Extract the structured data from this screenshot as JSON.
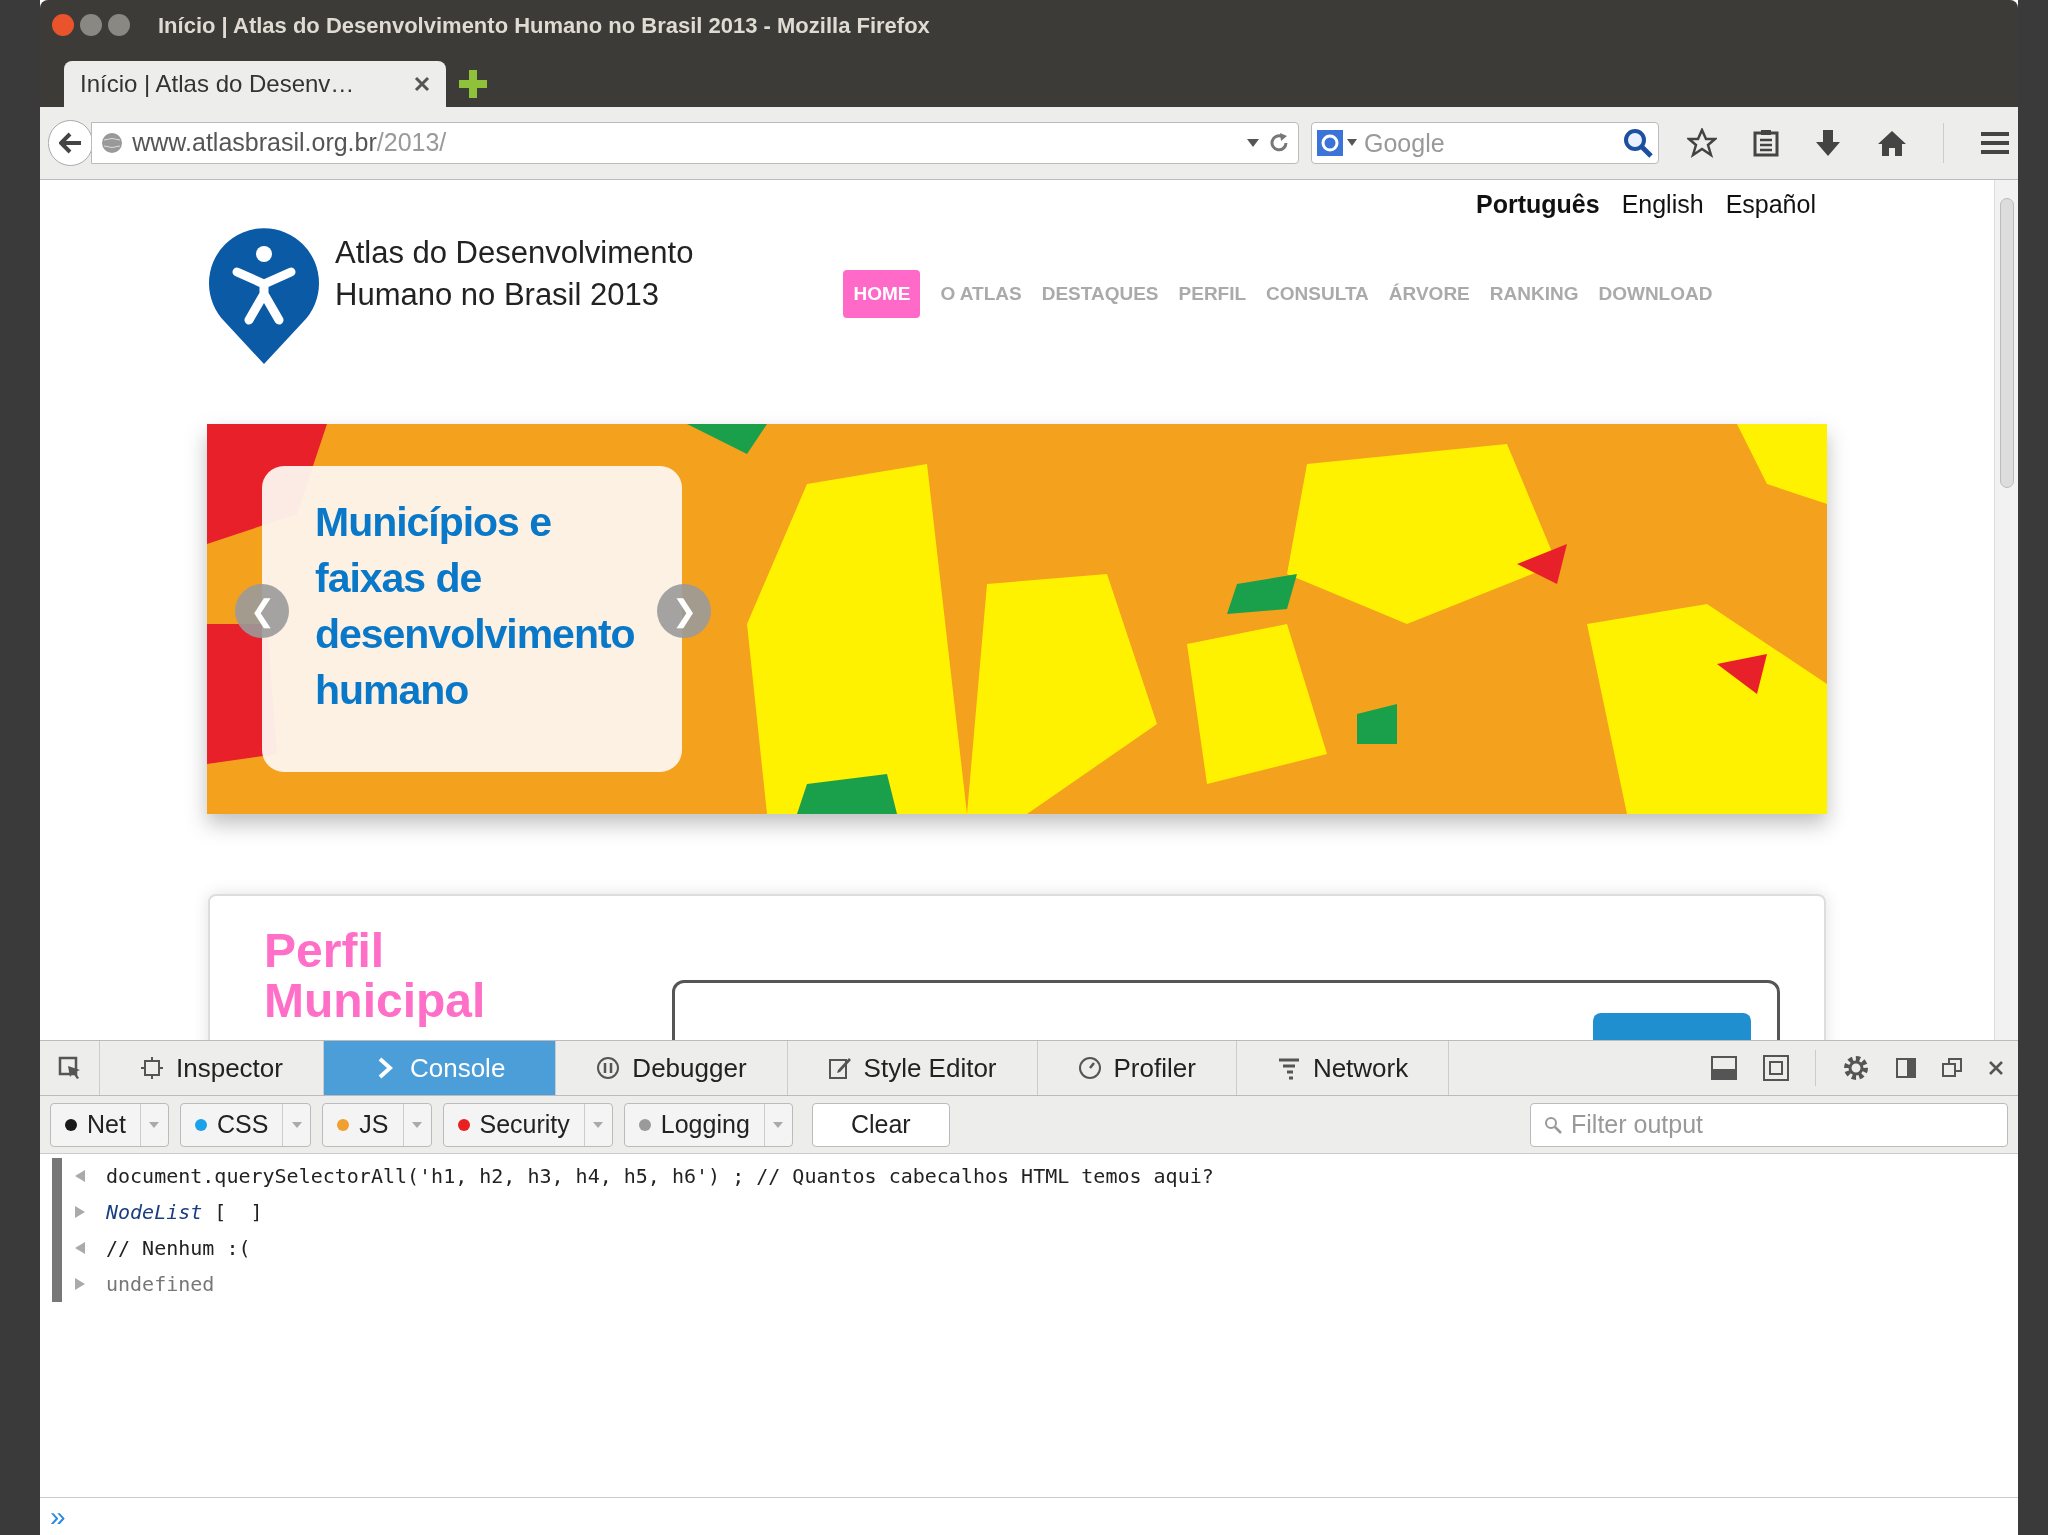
{
  "window": {
    "title": "Início | Atlas do Desenvolvimento Humano no Brasil 2013 - Mozilla Firefox"
  },
  "tabs": [
    {
      "label": "Início | Atlas do Desenv…",
      "selected": true
    }
  ],
  "address_bar": {
    "url_host": "www.atlasbrasil.org.br",
    "url_path": "/2013/"
  },
  "search": {
    "placeholder": "Google"
  },
  "page": {
    "languages": [
      {
        "label": "Português",
        "selected": true
      },
      {
        "label": "English",
        "selected": false
      },
      {
        "label": "Español",
        "selected": false
      }
    ],
    "logo_text": [
      "Atlas do Desenvolvimento",
      "Humano no Brasil 2013"
    ],
    "nav": [
      {
        "label": "HOME",
        "selected": true
      },
      {
        "label": "O ATLAS",
        "selected": false
      },
      {
        "label": "DESTAQUES",
        "selected": false
      },
      {
        "label": "PERFIL",
        "selected": false
      },
      {
        "label": "CONSULTA",
        "selected": false
      },
      {
        "label": "ÁRVORE",
        "selected": false
      },
      {
        "label": "RANKING",
        "selected": false
      },
      {
        "label": "DOWNLOAD",
        "selected": false
      }
    ],
    "slide": {
      "kind": "picture",
      "caption": "Municípios e faixas de desenvolvimento humano",
      "prev": "❮",
      "next": "❯"
    },
    "section_title": [
      "Perfil",
      "Municipal"
    ]
  },
  "devtools": {
    "tabs": [
      {
        "label": "Inspector",
        "selected": false
      },
      {
        "label": "Console",
        "selected": true
      },
      {
        "label": "Debugger",
        "selected": false
      },
      {
        "label": "Style Editor",
        "selected": false
      },
      {
        "label": "Profiler",
        "selected": false
      },
      {
        "label": "Network",
        "selected": false
      }
    ],
    "filters": [
      {
        "label": "Net",
        "color": "#1a1a1a"
      },
      {
        "label": "CSS",
        "color": "#1aa3e8"
      },
      {
        "label": "JS",
        "color": "#f0a030"
      },
      {
        "label": "Security",
        "color": "#e82020"
      },
      {
        "label": "Logging",
        "color": "#9a9a9a"
      }
    ],
    "clear": "Clear",
    "filter_placeholder": "Filter output",
    "console": [
      {
        "kind": "input",
        "text": "document.querySelectorAll('h1, h2, h3, h4, h5, h6') ; // Quantos cabecalhos HTML temos aqui?"
      },
      {
        "kind": "object",
        "text": "NodeList",
        "rest": "[  ]"
      },
      {
        "kind": "input",
        "text": "// Nenhum :("
      },
      {
        "kind": "undefined",
        "text": "undefined"
      }
    ],
    "prompt": "»"
  }
}
